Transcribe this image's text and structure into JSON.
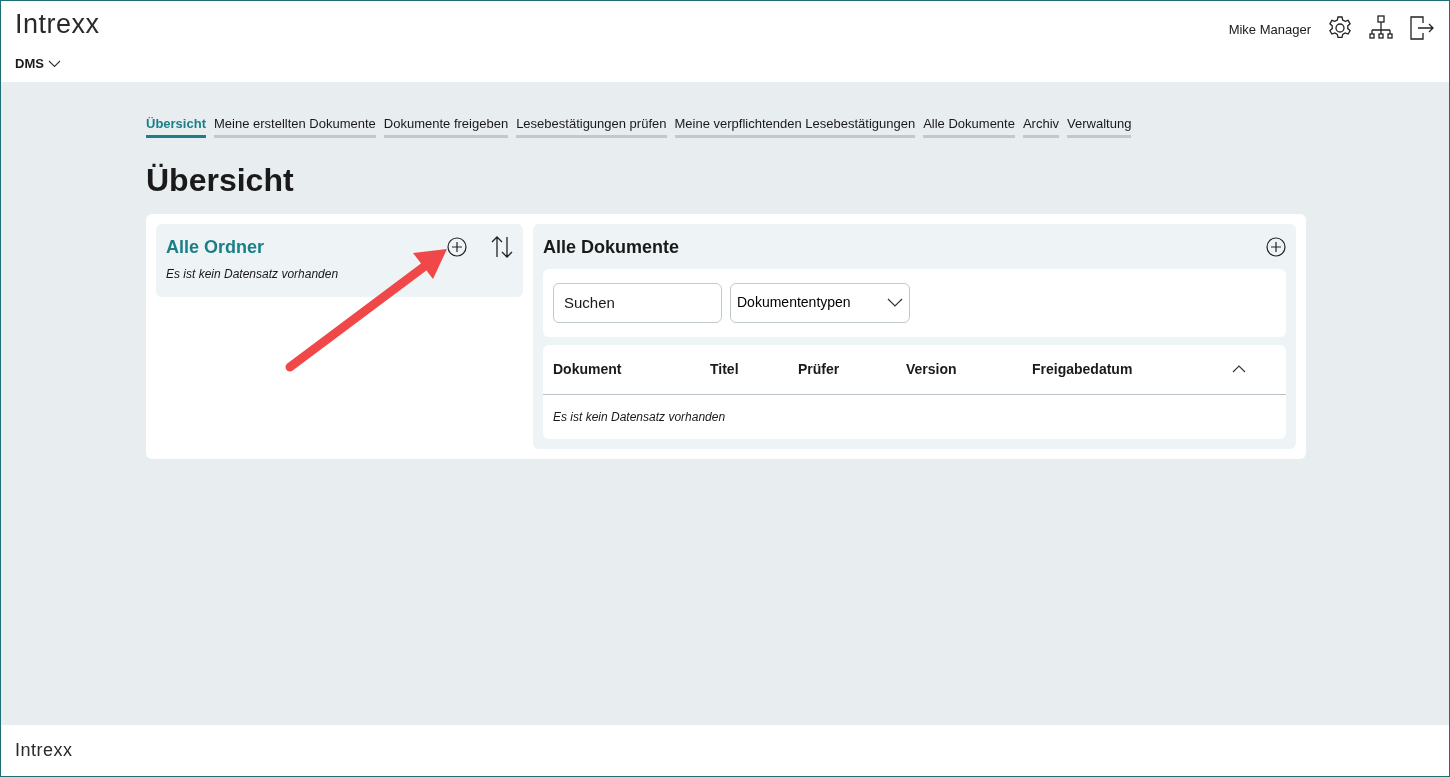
{
  "header": {
    "logo": "Intrexx",
    "app_menu": "DMS",
    "user": "Mike Manager"
  },
  "tabs": [
    {
      "label": "Übersicht",
      "selected": true
    },
    {
      "label": "Meine erstellten Dokumente",
      "selected": false
    },
    {
      "label": "Dokumente freigeben",
      "selected": false
    },
    {
      "label": "Lesebestätigungen prüfen",
      "selected": false
    },
    {
      "label": "Meine verpflichtenden Lesebestätigungen",
      "selected": false
    },
    {
      "label": "Alle Dokumente",
      "selected": false
    },
    {
      "label": "Archiv",
      "selected": false
    },
    {
      "label": "Verwaltung",
      "selected": false
    }
  ],
  "page_title": "Übersicht",
  "folders": {
    "title": "Alle Ordner",
    "empty_text": "Es ist kein Datensatz vorhanden"
  },
  "documents": {
    "title": "Alle Dokumente",
    "search": {
      "placeholder": "Suchen"
    },
    "type_filter": {
      "placeholder": "Dokumententypen"
    },
    "table": {
      "columns": [
        "Dokument",
        "Titel",
        "Prüfer",
        "Version",
        "Freigabedatum"
      ],
      "empty_text": "Es ist kein Datensatz vorhanden"
    }
  },
  "footer": {
    "logo": "Intrexx"
  }
}
